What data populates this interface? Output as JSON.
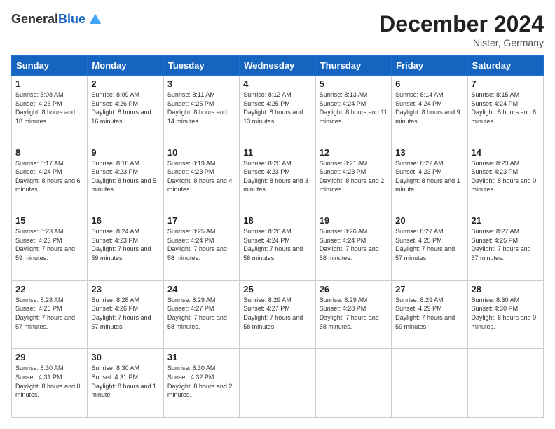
{
  "header": {
    "logo": {
      "line1": "General",
      "line2": "Blue"
    },
    "title": "December 2024",
    "location": "Nister, Germany"
  },
  "days_of_week": [
    "Sunday",
    "Monday",
    "Tuesday",
    "Wednesday",
    "Thursday",
    "Friday",
    "Saturday"
  ],
  "weeks": [
    [
      {
        "day": "1",
        "sunrise": "8:08 AM",
        "sunset": "4:26 PM",
        "daylight": "8 hours and 18 minutes."
      },
      {
        "day": "2",
        "sunrise": "8:09 AM",
        "sunset": "4:26 PM",
        "daylight": "8 hours and 16 minutes."
      },
      {
        "day": "3",
        "sunrise": "8:11 AM",
        "sunset": "4:25 PM",
        "daylight": "8 hours and 14 minutes."
      },
      {
        "day": "4",
        "sunrise": "8:12 AM",
        "sunset": "4:25 PM",
        "daylight": "8 hours and 13 minutes."
      },
      {
        "day": "5",
        "sunrise": "8:13 AM",
        "sunset": "4:24 PM",
        "daylight": "8 hours and 11 minutes."
      },
      {
        "day": "6",
        "sunrise": "8:14 AM",
        "sunset": "4:24 PM",
        "daylight": "8 hours and 9 minutes."
      },
      {
        "day": "7",
        "sunrise": "8:15 AM",
        "sunset": "4:24 PM",
        "daylight": "8 hours and 8 minutes."
      }
    ],
    [
      {
        "day": "8",
        "sunrise": "8:17 AM",
        "sunset": "4:24 PM",
        "daylight": "8 hours and 6 minutes."
      },
      {
        "day": "9",
        "sunrise": "8:18 AM",
        "sunset": "4:23 PM",
        "daylight": "8 hours and 5 minutes."
      },
      {
        "day": "10",
        "sunrise": "8:19 AM",
        "sunset": "4:23 PM",
        "daylight": "8 hours and 4 minutes."
      },
      {
        "day": "11",
        "sunrise": "8:20 AM",
        "sunset": "4:23 PM",
        "daylight": "8 hours and 3 minutes."
      },
      {
        "day": "12",
        "sunrise": "8:21 AM",
        "sunset": "4:23 PM",
        "daylight": "8 hours and 2 minutes."
      },
      {
        "day": "13",
        "sunrise": "8:22 AM",
        "sunset": "4:23 PM",
        "daylight": "8 hours and 1 minute."
      },
      {
        "day": "14",
        "sunrise": "8:23 AM",
        "sunset": "4:23 PM",
        "daylight": "8 hours and 0 minutes."
      }
    ],
    [
      {
        "day": "15",
        "sunrise": "8:23 AM",
        "sunset": "4:23 PM",
        "daylight": "7 hours and 59 minutes."
      },
      {
        "day": "16",
        "sunrise": "8:24 AM",
        "sunset": "4:23 PM",
        "daylight": "7 hours and 59 minutes."
      },
      {
        "day": "17",
        "sunrise": "8:25 AM",
        "sunset": "4:24 PM",
        "daylight": "7 hours and 58 minutes."
      },
      {
        "day": "18",
        "sunrise": "8:26 AM",
        "sunset": "4:24 PM",
        "daylight": "7 hours and 58 minutes."
      },
      {
        "day": "19",
        "sunrise": "8:26 AM",
        "sunset": "4:24 PM",
        "daylight": "7 hours and 58 minutes."
      },
      {
        "day": "20",
        "sunrise": "8:27 AM",
        "sunset": "4:25 PM",
        "daylight": "7 hours and 57 minutes."
      },
      {
        "day": "21",
        "sunrise": "8:27 AM",
        "sunset": "4:25 PM",
        "daylight": "7 hours and 57 minutes."
      }
    ],
    [
      {
        "day": "22",
        "sunrise": "8:28 AM",
        "sunset": "4:26 PM",
        "daylight": "7 hours and 57 minutes."
      },
      {
        "day": "23",
        "sunrise": "8:28 AM",
        "sunset": "4:26 PM",
        "daylight": "7 hours and 57 minutes."
      },
      {
        "day": "24",
        "sunrise": "8:29 AM",
        "sunset": "4:27 PM",
        "daylight": "7 hours and 58 minutes."
      },
      {
        "day": "25",
        "sunrise": "8:29 AM",
        "sunset": "4:27 PM",
        "daylight": "7 hours and 58 minutes."
      },
      {
        "day": "26",
        "sunrise": "8:29 AM",
        "sunset": "4:28 PM",
        "daylight": "7 hours and 58 minutes."
      },
      {
        "day": "27",
        "sunrise": "8:29 AM",
        "sunset": "4:29 PM",
        "daylight": "7 hours and 59 minutes."
      },
      {
        "day": "28",
        "sunrise": "8:30 AM",
        "sunset": "4:30 PM",
        "daylight": "8 hours and 0 minutes."
      }
    ],
    [
      {
        "day": "29",
        "sunrise": "8:30 AM",
        "sunset": "4:31 PM",
        "daylight": "8 hours and 0 minutes."
      },
      {
        "day": "30",
        "sunrise": "8:30 AM",
        "sunset": "4:31 PM",
        "daylight": "8 hours and 1 minute."
      },
      {
        "day": "31",
        "sunrise": "8:30 AM",
        "sunset": "4:32 PM",
        "daylight": "8 hours and 2 minutes."
      },
      null,
      null,
      null,
      null
    ]
  ]
}
